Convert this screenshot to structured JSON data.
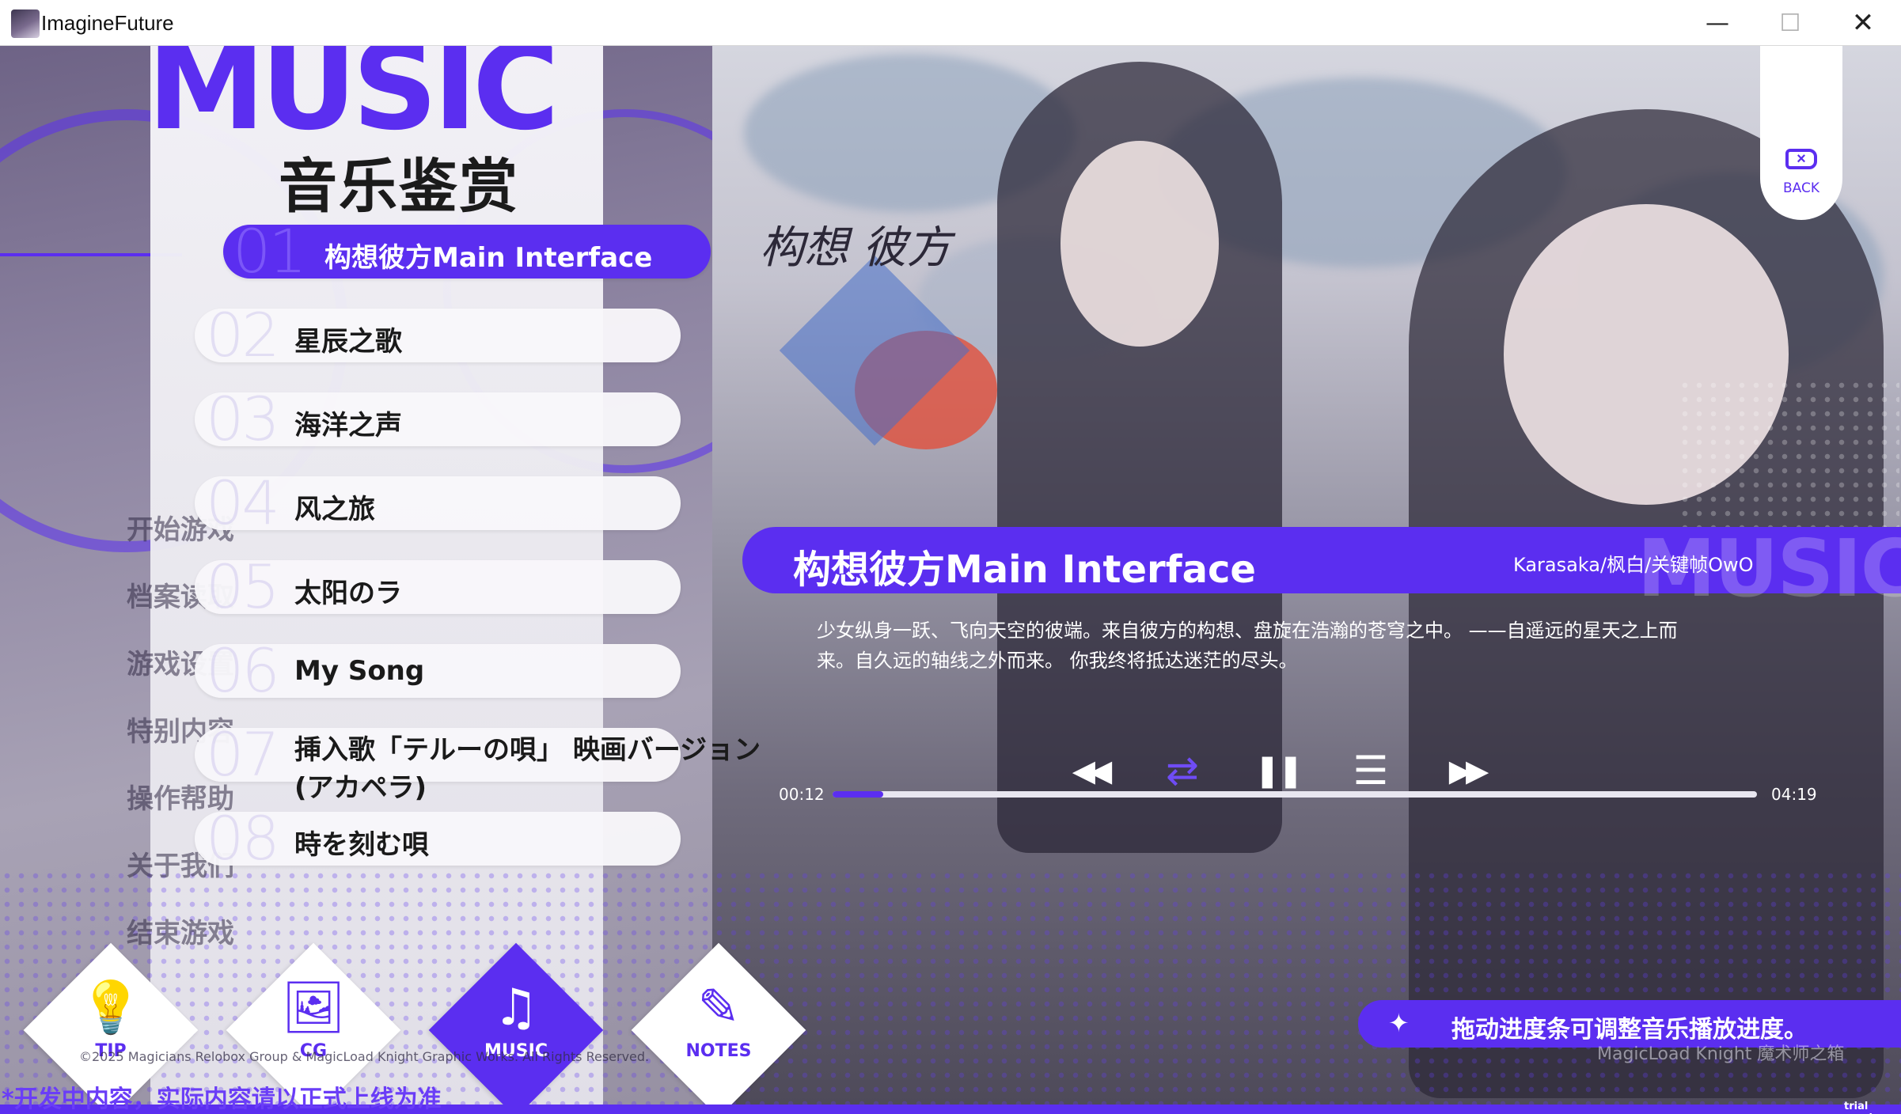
{
  "window": {
    "title": "ImagineFuture",
    "minimize_glyph": "—",
    "maximize_glyph": "☐",
    "close_glyph": "✕"
  },
  "header": {
    "music_word": "MUSIC",
    "subtitle": "音乐鉴赏"
  },
  "logo_text": "构想 彼方",
  "songs": [
    {
      "num": "01",
      "title": "构想彼方Main Interface",
      "active": true
    },
    {
      "num": "02",
      "title": "星辰之歌"
    },
    {
      "num": "03",
      "title": "海洋之声"
    },
    {
      "num": "04",
      "title": "风之旅"
    },
    {
      "num": "05",
      "title": "太阳のラ"
    },
    {
      "num": "06",
      "title": "My Song"
    },
    {
      "num": "07",
      "title": "挿入歌「テルーの唄」 映画バージョン (アカペラ)"
    },
    {
      "num": "08",
      "title": "時を刻む唄"
    }
  ],
  "back_button": {
    "label": "BACK",
    "icon": "backspace-icon"
  },
  "now_playing": {
    "title": "构想彼方Main Interface",
    "artist": "Karasaka/枫白/关键帧OwO",
    "bg_word": "MUSIC",
    "description": "少女纵身一跃、飞向天空的彼端。来自彼方的构想、盘旋在浩瀚的苍穹之中。 ——自遥远的星天之上而来。自久远的轴线之外而来。 你我终将抵达迷茫的尽头。"
  },
  "controls": {
    "prev": {
      "glyph": "◀◀",
      "icon": "rewind-icon"
    },
    "repeat": {
      "glyph": "⇄",
      "icon": "repeat-icon"
    },
    "pause": {
      "glyph": "❚❚",
      "icon": "pause-icon"
    },
    "playlist": {
      "glyph": "☰",
      "icon": "playlist-icon"
    },
    "next": {
      "glyph": "▶▶",
      "icon": "fast-forward-icon"
    }
  },
  "progress": {
    "current": "00:12",
    "total": "04:19",
    "fraction": 0.055
  },
  "hint": {
    "text": "拖动进度条可调整音乐播放进度。",
    "icon": "sparkle-icon"
  },
  "brand_marks": "MagicLoad Knight   魔术师之箱",
  "nav": [
    {
      "label": "TIP",
      "icon": "lightbulb-icon",
      "glyph": "💡",
      "active": false
    },
    {
      "label": "CG",
      "icon": "image-icon",
      "glyph": "🖼",
      "active": false
    },
    {
      "label": "MUSIC",
      "icon": "music-note-icon",
      "glyph": "♫",
      "active": true
    },
    {
      "label": "NOTES",
      "icon": "pencil-icon",
      "glyph": "✎",
      "active": false
    }
  ],
  "ghost_menu": [
    "开始游戏",
    "档案读取",
    "游戏设置",
    "特别内容",
    "操作帮助",
    "关于我们",
    "结束游戏"
  ],
  "copyright": "©2025 Magicians Relobox Group & MagicLoad Knight Graphic Works. All Rights Reserved.",
  "dev_note": "*开发中内容，实际内容请以正式上线为准",
  "trial": "trial version",
  "colors": {
    "accent": "#5b2ef0",
    "panel": "#f7f6fa",
    "text": "#1a1a1a"
  }
}
